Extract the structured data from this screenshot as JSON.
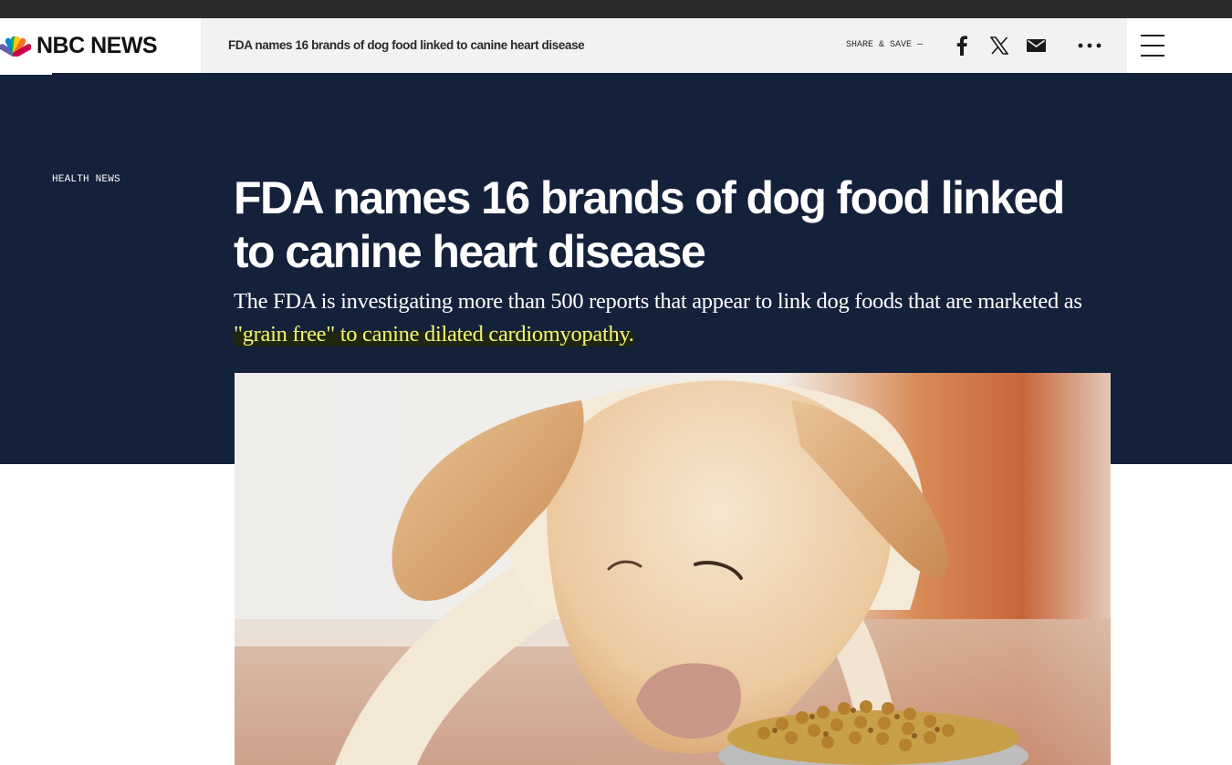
{
  "brand": {
    "name": "NBC NEWS",
    "peacock_colors": [
      "#6460aa",
      "#0089d0",
      "#0db14b",
      "#fccc12",
      "#f37021",
      "#cc004c"
    ]
  },
  "navbar": {
    "headline": "FDA names 16 brands of dog food linked to canine heart disease",
    "share_label": "SHARE & SAVE —",
    "icons": [
      "facebook-icon",
      "x-icon",
      "email-icon",
      "more-icon",
      "menu-icon"
    ]
  },
  "article": {
    "section": "HEALTH NEWS",
    "title": "FDA names 16 brands of dog food linked to canine heart disease",
    "dek_before": "The FDA is investigating more than 500 reports that appear to link dog foods that are marketed as ",
    "dek_highlighted": "\"grain free\" to canine dilated cardiomyopathy.",
    "hero_image": "dog-eating-from-food-bowl"
  },
  "colors": {
    "hero_background": "#14213a",
    "highlight_text": "#f3f57a",
    "top_strip": "#2b2b2b"
  }
}
